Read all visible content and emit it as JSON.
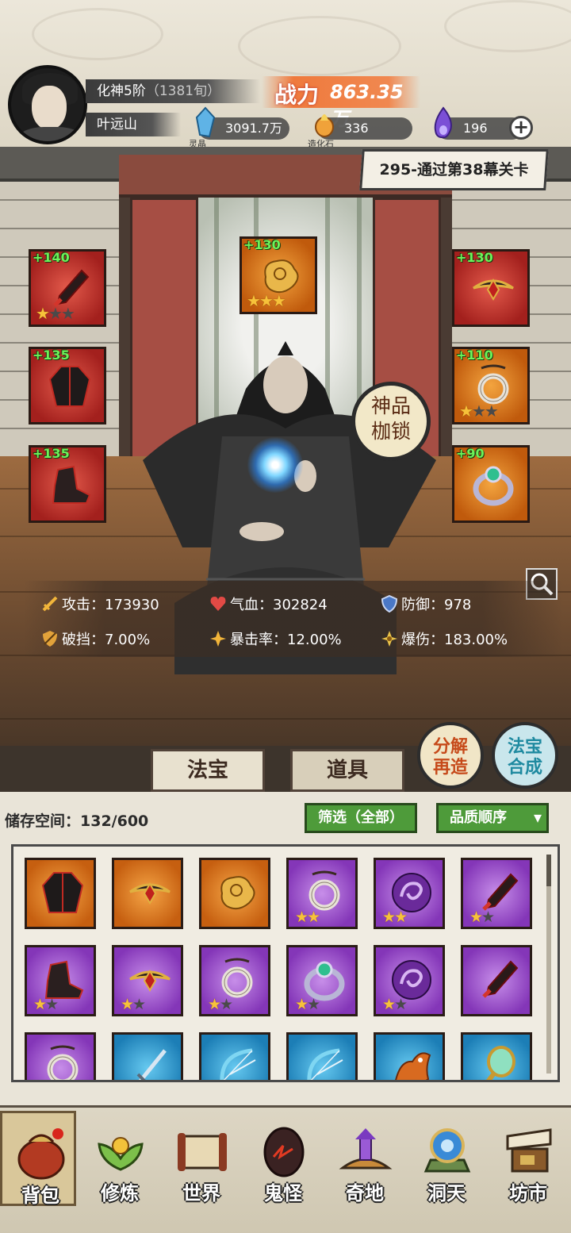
{
  "player": {
    "rank": "化神5阶",
    "age": "（1381旬）",
    "name": "叶远山"
  },
  "power": {
    "label": "战力",
    "value": "863.35万"
  },
  "resources": [
    {
      "name": "灵晶",
      "value": "3091.7万",
      "icon": "blue-crystal-icon",
      "color": "#5fb3e6"
    },
    {
      "name": "造化石",
      "value": "336",
      "icon": "fire-stone-icon",
      "color": "#f0a23a"
    },
    {
      "name": "",
      "value": "196",
      "icon": "purple-flame-icon",
      "color": "#7b4fd6"
    }
  ],
  "quest": "295-通过第38幕关卡",
  "seal_label": "神品\n枷锁",
  "equipped": [
    {
      "slot": "weapon",
      "level": "+140",
      "rarity": "red",
      "stars": 1,
      "icon": "dagger-icon"
    },
    {
      "slot": "armor",
      "level": "+135",
      "rarity": "red",
      "stars": 0,
      "icon": "robe-icon"
    },
    {
      "slot": "boots",
      "level": "+135",
      "rarity": "red",
      "stars": 0,
      "icon": "boots-icon"
    },
    {
      "slot": "talisman",
      "level": "+130",
      "rarity": "orange",
      "stars": 3,
      "icon": "golden-cloud-icon"
    },
    {
      "slot": "headband",
      "level": "+130",
      "rarity": "red",
      "stars": 0,
      "icon": "headband-icon"
    },
    {
      "slot": "pendant",
      "level": "+110",
      "rarity": "orange",
      "stars": 1,
      "icon": "jade-pendant-icon"
    },
    {
      "slot": "ring",
      "level": "+90",
      "rarity": "orange",
      "stars": 0,
      "icon": "ring-icon"
    }
  ],
  "stats": [
    {
      "label": "攻击：",
      "value": "173930",
      "icon": "sword-icon"
    },
    {
      "label": "气血：",
      "value": "302824",
      "icon": "heart-icon"
    },
    {
      "label": "防御：",
      "value": "978",
      "icon": "shield-icon"
    },
    {
      "label": "破挡：",
      "value": "7.00%",
      "icon": "shield-break-icon"
    },
    {
      "label": "暴击率：",
      "value": "12.00%",
      "icon": "crit-icon"
    },
    {
      "label": "爆伤：",
      "value": "183.00%",
      "icon": "crit-damage-icon"
    }
  ],
  "tabs": {
    "fabao": "法宝",
    "daoju": "道具"
  },
  "actions": {
    "decompose": "分解\n再造",
    "synthesize": "法宝\n合成"
  },
  "inventory": {
    "storage_label": "储存空间：",
    "storage_value": "132/600",
    "filter": "筛选（全部）",
    "sort": "品质顺序",
    "items": [
      {
        "rarity": "orange",
        "stars": 0,
        "icon": "robe-icon"
      },
      {
        "rarity": "orange",
        "stars": 0,
        "icon": "headband-icon"
      },
      {
        "rarity": "orange",
        "stars": 0,
        "icon": "golden-cloud-icon"
      },
      {
        "rarity": "purple",
        "stars": 2,
        "max": 2,
        "icon": "jade-pendant-icon"
      },
      {
        "rarity": "purple",
        "stars": 2,
        "max": 2,
        "icon": "purple-swirl-icon"
      },
      {
        "rarity": "purple",
        "stars": 1,
        "max": 2,
        "icon": "dagger-icon"
      },
      {
        "rarity": "purple",
        "stars": 1,
        "max": 2,
        "icon": "boots-icon"
      },
      {
        "rarity": "purple",
        "stars": 1,
        "max": 2,
        "icon": "headband-icon"
      },
      {
        "rarity": "purple",
        "stars": 1,
        "max": 2,
        "icon": "jade-pendant-icon"
      },
      {
        "rarity": "purple",
        "stars": 1,
        "max": 2,
        "icon": "ring-icon"
      },
      {
        "rarity": "purple",
        "stars": 1,
        "max": 2,
        "icon": "purple-swirl-icon"
      },
      {
        "rarity": "purple",
        "stars": 0,
        "max": 0,
        "icon": "dagger-icon"
      },
      {
        "rarity": "purple",
        "stars": 0,
        "max": 0,
        "icon": "jade-pendant-icon"
      },
      {
        "rarity": "blue",
        "stars": 0,
        "max": 0,
        "icon": "sword-icon"
      },
      {
        "rarity": "blue",
        "stars": 0,
        "max": 0,
        "icon": "bow-icon"
      },
      {
        "rarity": "blue",
        "stars": 0,
        "max": 0,
        "icon": "bow-icon"
      },
      {
        "rarity": "blue",
        "stars": 0,
        "max": 0,
        "icon": "fire-beast-icon"
      },
      {
        "rarity": "blue",
        "stars": 0,
        "max": 0,
        "icon": "mirror-icon"
      }
    ]
  },
  "nav": [
    {
      "label": "背包",
      "icon": "bag-icon"
    },
    {
      "label": "修炼",
      "icon": "lotus-icon"
    },
    {
      "label": "世界",
      "icon": "scroll-map-icon"
    },
    {
      "label": "鬼怪",
      "icon": "demon-egg-icon"
    },
    {
      "label": "奇地",
      "icon": "pagoda-icon"
    },
    {
      "label": "洞天",
      "icon": "portal-icon"
    },
    {
      "label": "坊市",
      "icon": "market-stall-icon"
    }
  ]
}
